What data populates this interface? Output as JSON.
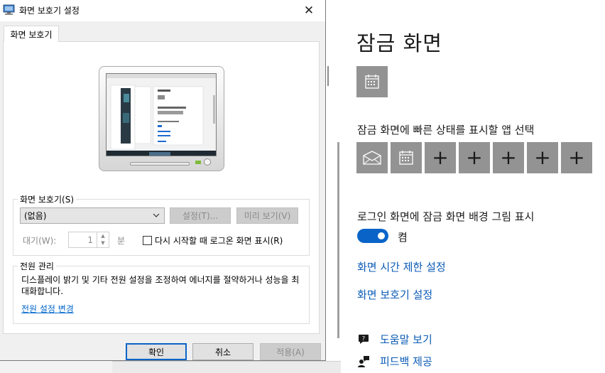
{
  "dialog": {
    "title": "화면 보호기 설정",
    "tab": "화면 보호기",
    "screensaver_group_label": "화면 보호기(S)",
    "screensaver_selected": "(없음)",
    "settings_button": "설정(T)...",
    "preview_button": "미리 보기(V)",
    "wait_label": "대기(W):",
    "wait_value": "1",
    "wait_unit": "분",
    "resume_checkbox_label": "다시 시작할 때 로그온 화면 표시(R)",
    "resume_checked": false,
    "power_group_label": "전원 관리",
    "power_text": "디스플레이 밝기 및 기타 전원 설정을 조정하여 에너지를 절약하거나 성능을 최대화합니다.",
    "power_link": "전원 설정 변경",
    "ok_button": "확인",
    "cancel_button": "취소",
    "apply_button": "적용(A)"
  },
  "settings_page": {
    "title": "잠금 화면",
    "detailed_app_icon": "calendar-icon",
    "quick_status_label": "잠금 화면에 빠른 상태를 표시할 앱 선택",
    "quick_status_apps": [
      "mail-icon",
      "calendar-icon",
      "plus-icon",
      "plus-icon",
      "plus-icon",
      "plus-icon",
      "plus-icon"
    ],
    "plus_symbol": "+",
    "signin_bg_label": "로그인 화면에 잠금 화면 배경 그림 표시",
    "signin_bg_toggle_text": "켬",
    "signin_bg_toggle_on": true,
    "screen_timeout_link": "화면 시간 제한 설정",
    "screensaver_link": "화면 보호기 설정",
    "help_link": "도움말 보기",
    "feedback_link": "피드백 제공"
  },
  "colors": {
    "accent": "#0a64c8",
    "link": "#0a5bb6",
    "tile": "#939393"
  }
}
